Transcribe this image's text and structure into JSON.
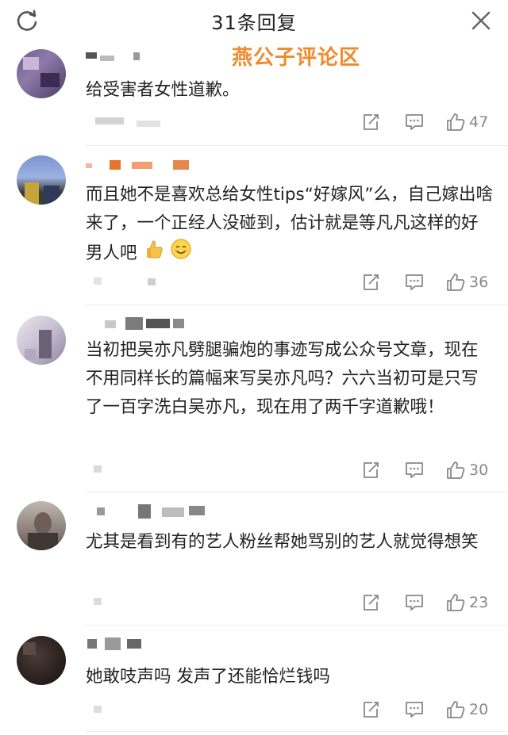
{
  "header": {
    "title": "31条回复",
    "refresh_icon": "refresh-icon",
    "close_icon": "close-icon"
  },
  "watermark": "燕公子评论区",
  "comments": [
    {
      "text": "给受害者女性道歉。",
      "likes": "47"
    },
    {
      "text": "而且她不是喜欢总给女性tips“好嫁风”么，自己嫁出啥来了，一个正经人没碰到，估计就是等凡凡这样的好男人吧",
      "likes": "36"
    },
    {
      "text": "当初把吴亦凡劈腿骗炮的事迹写成公众号文章，现在不用同样长的篇幅来写吴亦凡吗？六六当初可是只写了一百字洗白吴亦凡，现在用了两千字道歉哦！",
      "likes": "30"
    },
    {
      "text": "尤其是看到有的艺人粉丝帮她骂别的艺人就觉得想笑",
      "likes": "23"
    },
    {
      "text": "她敢吱声吗 发声了还能恰烂钱吗",
      "likes": "20"
    }
  ],
  "colors": {
    "watermark": "#f08a2c",
    "icon_gray": "#8a8a8a",
    "text": "#222222"
  }
}
